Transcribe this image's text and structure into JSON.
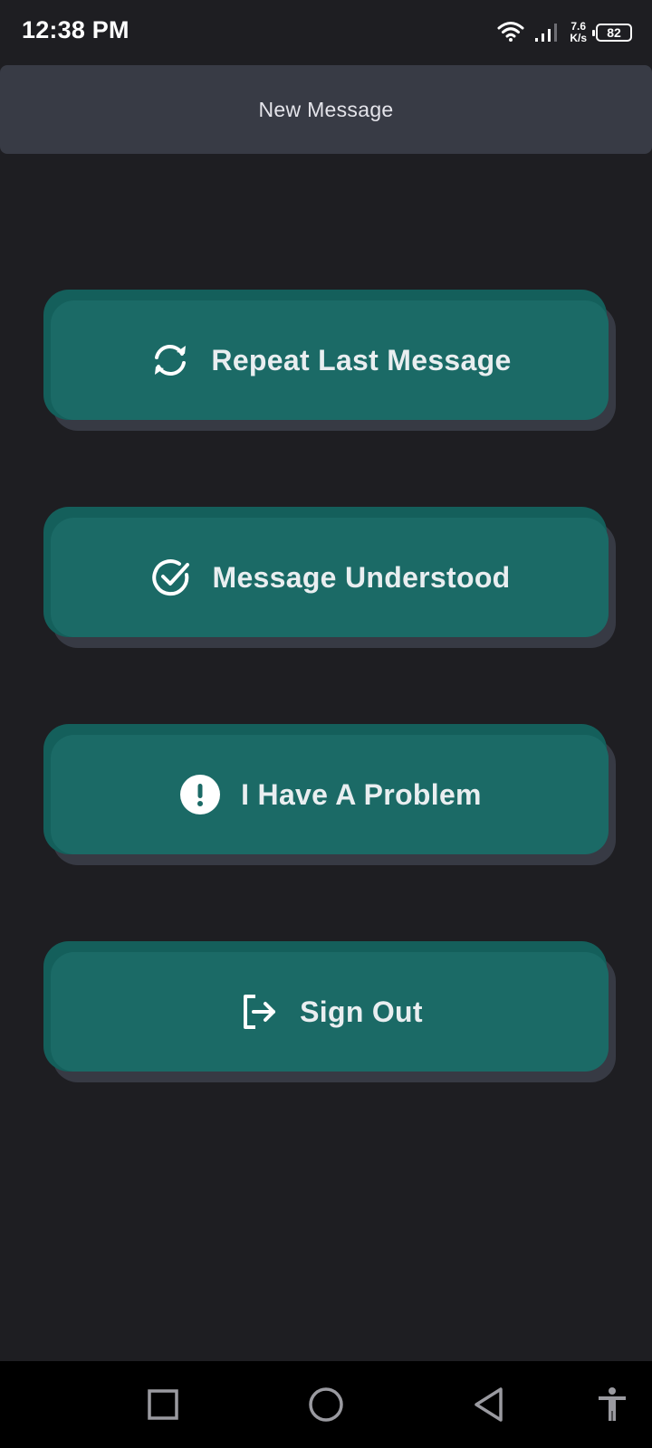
{
  "status_bar": {
    "time": "12:38 PM",
    "speed_value": "7.6",
    "speed_unit": "K/s",
    "battery": "82",
    "icons": [
      "wifi-icon",
      "signal-icon",
      "battery-icon"
    ]
  },
  "app_bar": {
    "title": "New Message"
  },
  "actions": [
    {
      "label": "Repeat Last Message",
      "icon": "refresh-icon"
    },
    {
      "label": "Message Understood",
      "icon": "check-circle-icon"
    },
    {
      "label": "I Have A Problem",
      "icon": "alert-circle-icon"
    },
    {
      "label": "Sign Out",
      "icon": "logout-icon"
    }
  ],
  "nav_bar": {
    "icons": [
      "recents-square-icon",
      "home-circle-icon",
      "back-triangle-icon",
      "accessibility-icon"
    ]
  },
  "colors": {
    "background": "#1e1e22",
    "app_bar": "#383b45",
    "button_face": "#1b6a66",
    "button_back": "#145f5b",
    "button_shadow": "#373a44",
    "button_text": "#e9eef0"
  }
}
